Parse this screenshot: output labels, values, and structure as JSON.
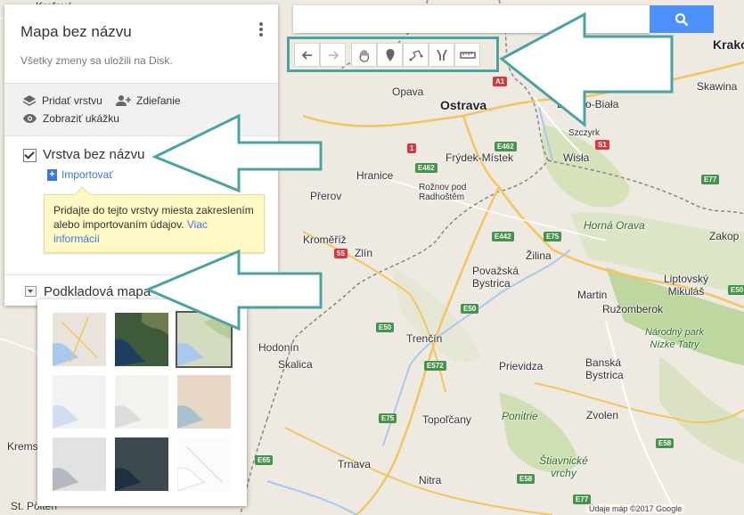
{
  "panel": {
    "title": "Mapa bez názvu",
    "subtitle": "Všetky zmeny sa uložili na Disk.",
    "actions": {
      "add_layer": "Pridať vrstvu",
      "share": "Zdieľanie",
      "preview": "Zobraziť ukážku"
    },
    "layer": {
      "name": "Vrstva bez názvu",
      "import": "Importovať",
      "tip_text": "Pridajte do tejto vrstvy miesta zakreslením alebo importovaním údajov.",
      "tip_link": "Viac informácií"
    },
    "basemap": {
      "label": "Podkladová mapa"
    }
  },
  "search": {
    "placeholder": ""
  },
  "map": {
    "cities": [
      {
        "name": "Ostrava",
        "big": true
      },
      {
        "name": "Opava"
      },
      {
        "name": "Bielsko-Biała"
      },
      {
        "name": "Krakó"
      },
      {
        "name": "Skawina"
      },
      {
        "name": "Frýdek-Místek"
      },
      {
        "name": "Hranice"
      },
      {
        "name": "Rožnov pod Radhoštěm"
      },
      {
        "name": "Szczyrk"
      },
      {
        "name": "Wisła"
      },
      {
        "name": "Přerov"
      },
      {
        "name": "Kroměříž"
      },
      {
        "name": "Zlín"
      },
      {
        "name": "Považská Bystrica"
      },
      {
        "name": "Žilina"
      },
      {
        "name": "Zakop"
      },
      {
        "name": "Martin"
      },
      {
        "name": "Liptovský Mikuláš"
      },
      {
        "name": "Ružomberok"
      },
      {
        "name": "Hodonín"
      },
      {
        "name": "Skalica"
      },
      {
        "name": "Trenčín"
      },
      {
        "name": "Prievidza"
      },
      {
        "name": "Banská Bystrica"
      },
      {
        "name": "Topoľčany"
      },
      {
        "name": "Zvolen"
      },
      {
        "name": "Trnava"
      },
      {
        "name": "Nitra"
      },
      {
        "name": "Krems"
      },
      {
        "name": "St. Pölten"
      },
      {
        "name": "Kraków"
      },
      {
        "name": "Hradiště"
      },
      {
        "name": "Vsetín"
      }
    ],
    "regions": [
      "Horná Orava",
      "Národný park Nízke Tatry",
      "Ponitrie",
      "Štiavnické vrchy"
    ],
    "attribution": "Údaje máp ©2017 Google"
  },
  "toolbar": {
    "tools": [
      "undo",
      "redo",
      "pan",
      "marker",
      "draw-line",
      "route",
      "ruler"
    ]
  }
}
